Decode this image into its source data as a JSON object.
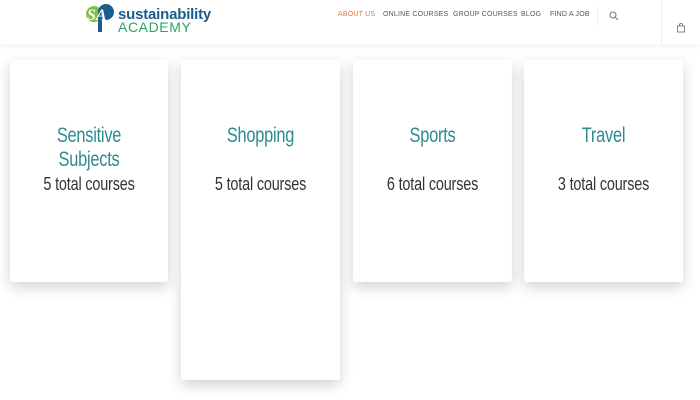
{
  "header": {
    "logo": {
      "mark": "SA",
      "line1": "sustainability",
      "line2": "ACADEMY"
    },
    "nav": [
      {
        "label": "ABOUT US",
        "active": true
      },
      {
        "label": "ONLINE COURSES",
        "active": false
      },
      {
        "label": "GROUP COURSES",
        "active": false
      },
      {
        "label": "BLOG",
        "active": false
      },
      {
        "label": "FIND A JOB",
        "active": false
      }
    ],
    "icons": {
      "search": "search-icon",
      "cart": "shopping-bag-icon"
    },
    "accent_color": "#e07b39"
  },
  "categories": [
    {
      "title": "Sensitive Subjects",
      "count": "5 total courses"
    },
    {
      "title": "Shopping",
      "count": "5 total courses"
    },
    {
      "title": "Sports",
      "count": "6 total courses"
    },
    {
      "title": "Travel",
      "count": "3 total courses"
    }
  ],
  "colors": {
    "title": "#2e8a8f",
    "count": "#333333",
    "logo_blue": "#1a5d8f",
    "logo_green": "#29a36a"
  }
}
